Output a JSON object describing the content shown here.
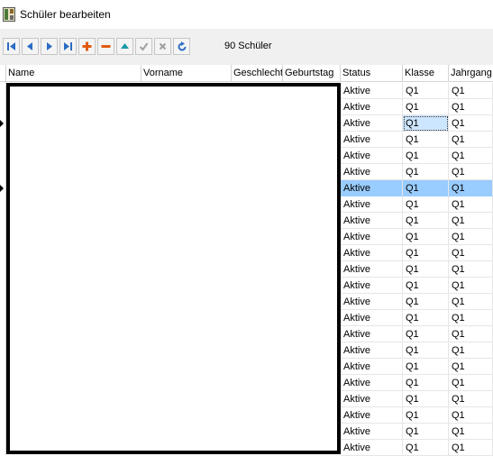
{
  "window": {
    "title": "Schüler bearbeiten"
  },
  "toolbar": {
    "count_label": "90 Schüler",
    "buttons": [
      {
        "name": "first-record-button",
        "icon": "first-icon"
      },
      {
        "name": "prev-record-button",
        "icon": "prev-icon"
      },
      {
        "name": "next-record-button",
        "icon": "next-icon"
      },
      {
        "name": "last-record-button",
        "icon": "last-icon"
      },
      {
        "name": "add-record-button",
        "icon": "plus-icon"
      },
      {
        "name": "delete-record-button",
        "icon": "minus-icon"
      },
      {
        "name": "edit-record-button",
        "icon": "up-icon"
      },
      {
        "name": "post-record-button",
        "icon": "check-icon"
      },
      {
        "name": "cancel-record-button",
        "icon": "cancel-icon"
      },
      {
        "name": "refresh-button",
        "icon": "refresh-icon"
      }
    ]
  },
  "grid": {
    "columns": [
      "Name",
      "Vorname",
      "Geschlecht",
      "Geburtstag",
      "Status",
      "Klasse",
      "Jahrgang"
    ],
    "rows": [
      [
        "Aktive",
        "Q1",
        "Q1"
      ],
      [
        "Aktive",
        "Q1",
        "Q1"
      ],
      [
        "Aktive",
        "Q1",
        "Q1"
      ],
      [
        "Aktive",
        "Q1",
        "Q1"
      ],
      [
        "Aktive",
        "Q1",
        "Q1"
      ],
      [
        "Aktive",
        "Q1",
        "Q1"
      ],
      [
        "Aktive",
        "Q1",
        "Q1"
      ],
      [
        "Aktive",
        "Q1",
        "Q1"
      ],
      [
        "Aktive",
        "Q1",
        "Q1"
      ],
      [
        "Aktive",
        "Q1",
        "Q1"
      ],
      [
        "Aktive",
        "Q1",
        "Q1"
      ],
      [
        "Aktive",
        "Q1",
        "Q1"
      ],
      [
        "Aktive",
        "Q1",
        "Q1"
      ],
      [
        "Aktive",
        "Q1",
        "Q1"
      ],
      [
        "Aktive",
        "Q1",
        "Q1"
      ],
      [
        "Aktive",
        "Q1",
        "Q1"
      ],
      [
        "Aktive",
        "Q1",
        "Q1"
      ],
      [
        "Aktive",
        "Q1",
        "Q1"
      ],
      [
        "Aktive",
        "Q1",
        "Q1"
      ],
      [
        "Aktive",
        "Q1",
        "Q1"
      ],
      [
        "Aktive",
        "Q1",
        "Q1"
      ],
      [
        "Aktive",
        "Q1",
        "Q1"
      ],
      [
        "Aktive",
        "Q1",
        "Q1"
      ]
    ],
    "selected_row_index": 6,
    "focused_row_index": 2,
    "selection_color": "#99ccff"
  }
}
